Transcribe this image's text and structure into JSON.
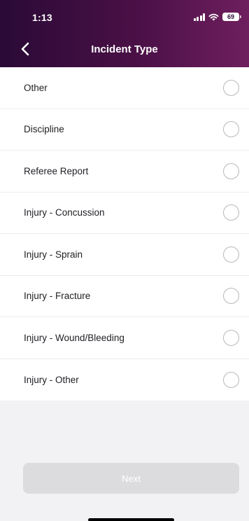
{
  "status_bar": {
    "time": "1:13",
    "battery": "69",
    "icons": [
      "signal-icon",
      "wifi-icon",
      "battery-icon"
    ]
  },
  "header": {
    "title": "Incident Type",
    "back_icon": "chevron-left-icon",
    "gradient_colors": [
      "#2a0a36",
      "#4a1046",
      "#6f1f5e"
    ]
  },
  "options": [
    {
      "label": "Other",
      "selected": false
    },
    {
      "label": "Discipline",
      "selected": false
    },
    {
      "label": "Referee Report",
      "selected": false
    },
    {
      "label": "Injury - Concussion",
      "selected": false
    },
    {
      "label": "Injury - Sprain",
      "selected": false
    },
    {
      "label": "Injury - Fracture",
      "selected": false
    },
    {
      "label": "Injury - Wound/Bleeding",
      "selected": false
    },
    {
      "label": "Injury - Other",
      "selected": false
    }
  ],
  "footer": {
    "next_label": "Next",
    "next_enabled": false
  }
}
